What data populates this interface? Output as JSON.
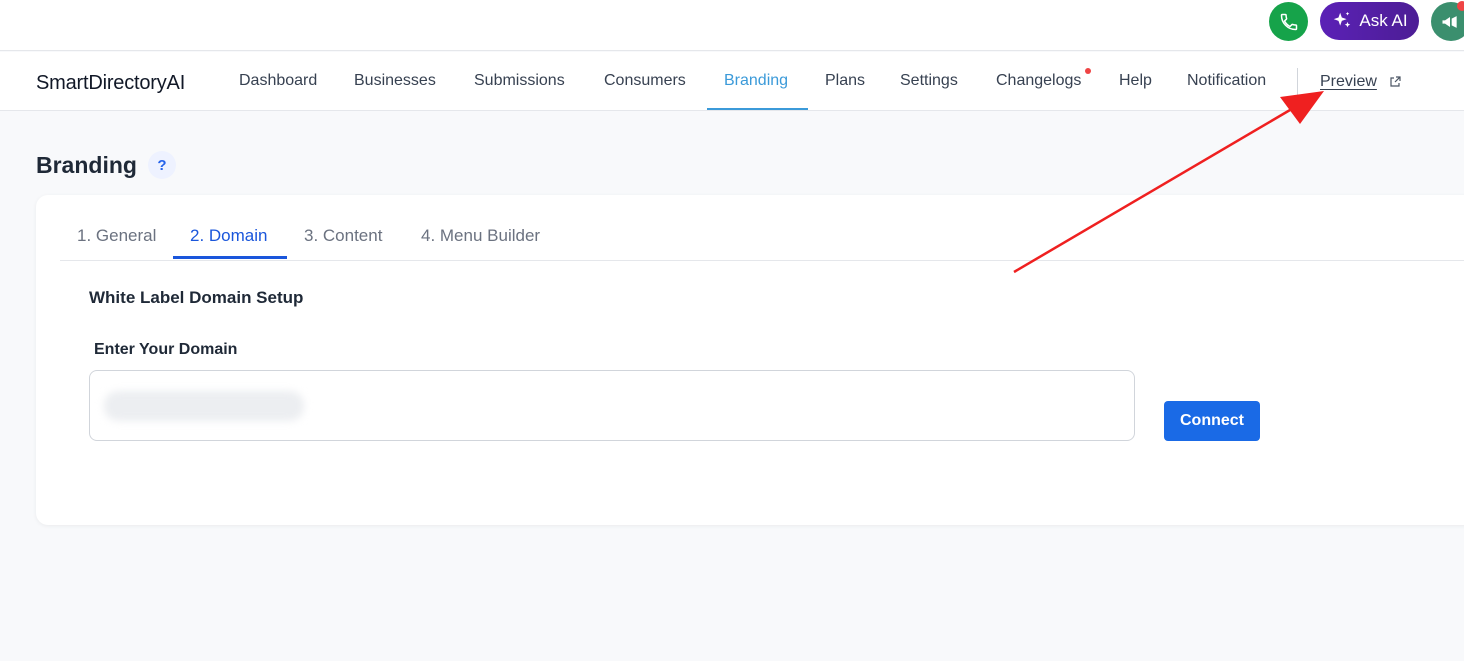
{
  "topbar": {
    "ask_ai_label": "Ask AI",
    "icons": [
      "phone-icon",
      "sparkle-icon",
      "megaphone-icon"
    ]
  },
  "nav": {
    "brand": "SmartDirectoryAI",
    "items": [
      {
        "label": "Dashboard"
      },
      {
        "label": "Businesses"
      },
      {
        "label": "Submissions"
      },
      {
        "label": "Consumers"
      },
      {
        "label": "Branding"
      },
      {
        "label": "Plans"
      },
      {
        "label": "Settings"
      },
      {
        "label": "Changelogs"
      },
      {
        "label": "Help"
      },
      {
        "label": "Notification"
      }
    ],
    "active": "Branding",
    "preview_label": "Preview"
  },
  "page": {
    "title": "Branding",
    "help_label": "?"
  },
  "tabs": [
    {
      "label": "1. General"
    },
    {
      "label": "2. Domain"
    },
    {
      "label": "3. Content"
    },
    {
      "label": "4. Menu Builder"
    }
  ],
  "active_tab": "2. Domain",
  "domain_setup": {
    "section_title": "White Label Domain Setup",
    "field_label": "Enter Your Domain",
    "connect_label": "Connect"
  },
  "colors": {
    "nav_active": "#3b9ad9",
    "tab_active": "#1a56db",
    "button_primary": "#1a6ae6",
    "ask_ai": "#5b21b6",
    "phone": "#16a34a",
    "annotation_arrow": "#ef2020"
  }
}
